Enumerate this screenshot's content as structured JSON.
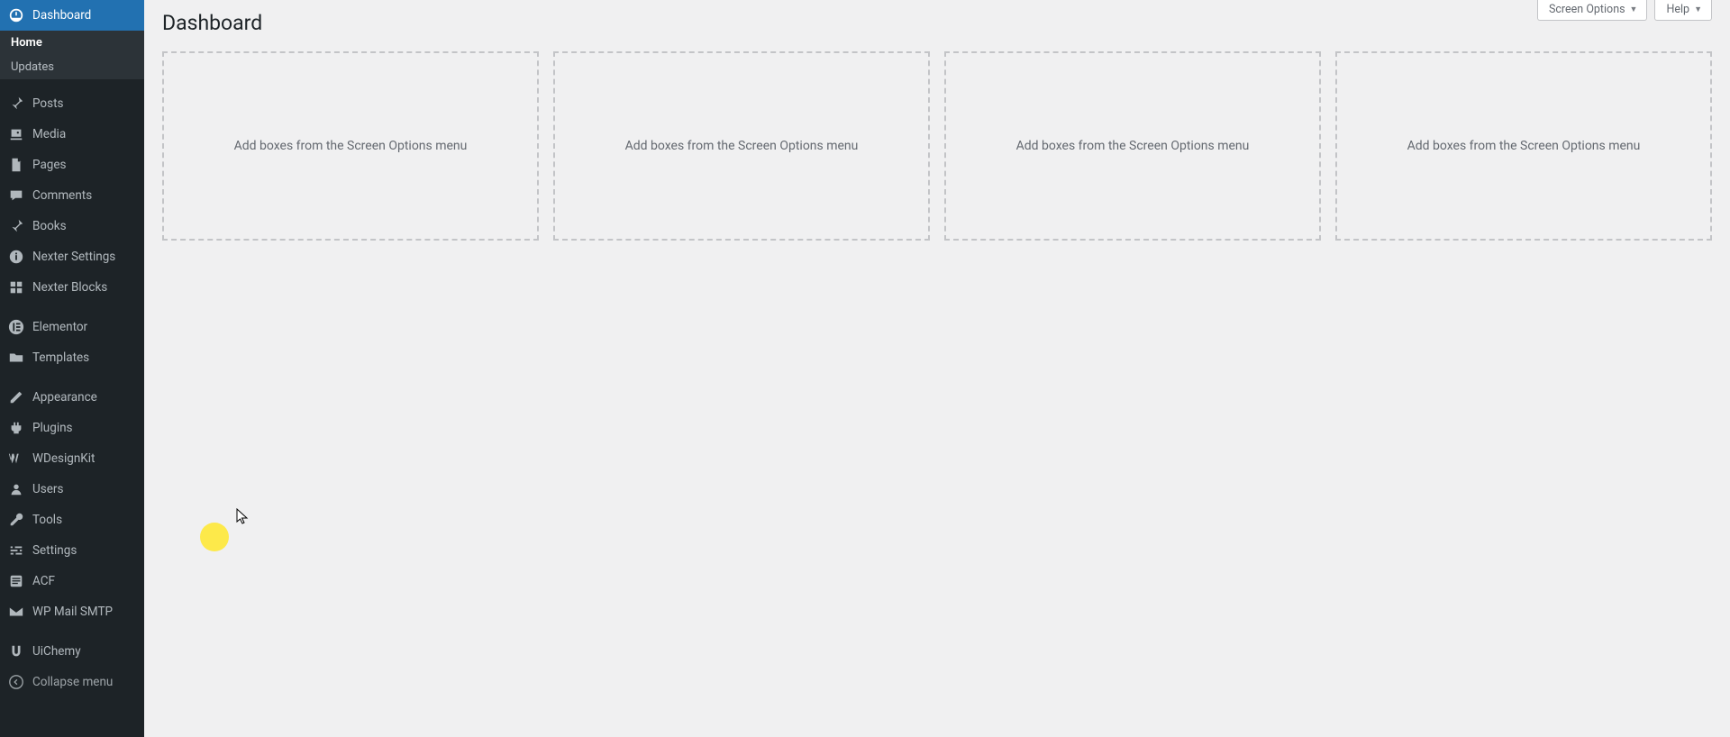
{
  "header": {
    "page_title": "Dashboard",
    "screen_options_label": "Screen Options",
    "help_label": "Help"
  },
  "sidebar": {
    "items": [
      {
        "icon": "dashboard",
        "label": "Dashboard",
        "current": true
      },
      {
        "icon": "pin",
        "label": "Posts"
      },
      {
        "icon": "media",
        "label": "Media"
      },
      {
        "icon": "page",
        "label": "Pages"
      },
      {
        "icon": "comments",
        "label": "Comments"
      },
      {
        "icon": "pin",
        "label": "Books"
      },
      {
        "icon": "info",
        "label": "Nexter Settings"
      },
      {
        "icon": "blocks",
        "label": "Nexter Blocks"
      },
      {
        "icon": "elementor",
        "label": "Elementor"
      },
      {
        "icon": "folder",
        "label": "Templates"
      },
      {
        "icon": "appearance",
        "label": "Appearance"
      },
      {
        "icon": "plugin",
        "label": "Plugins"
      },
      {
        "icon": "wdesignkit",
        "label": "WDesignKit"
      },
      {
        "icon": "users",
        "label": "Users"
      },
      {
        "icon": "tools",
        "label": "Tools"
      },
      {
        "icon": "settings",
        "label": "Settings"
      },
      {
        "icon": "acf",
        "label": "ACF"
      },
      {
        "icon": "mail",
        "label": "WP Mail SMTP"
      },
      {
        "icon": "uichemy",
        "label": "UiChemy"
      }
    ],
    "submenu_dashboard": [
      {
        "label": "Home",
        "current": true
      },
      {
        "label": "Updates"
      }
    ],
    "collapse_label": "Collapse menu"
  },
  "dashboard": {
    "dropzone_text": "Add boxes from the Screen Options menu"
  }
}
